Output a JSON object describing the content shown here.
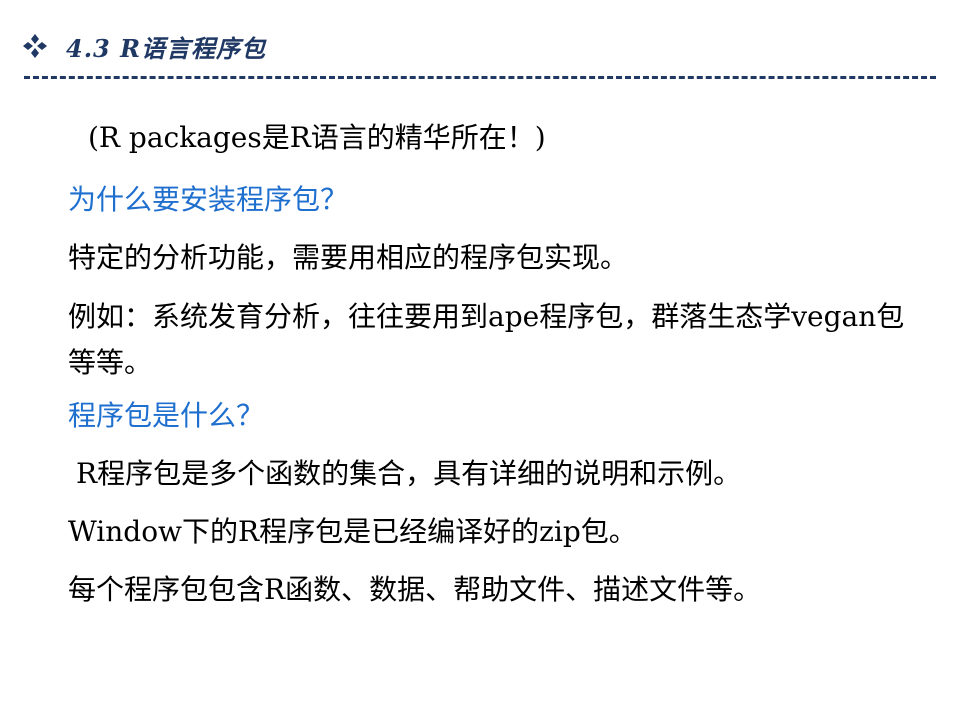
{
  "header": {
    "icon": "four-diamond-bullet-icon",
    "title": "4.3 R语言程序包",
    "title_color": "#1f3864"
  },
  "content": {
    "subtitle": "(R packages是R语言的精华所在！)",
    "q1": "为什么要安装程序包？",
    "a1": "特定的分析功能，需要用相应的程序包实现。",
    "example": "例如：系统发育分析，往往要用到ape程序包，群落生态学vegan包等等。",
    "q2": "程序包是什么？",
    "a2_line1": "R程序包是多个函数的集合，具有详细的说明和示例。",
    "a2_line2": "Window下的R程序包是已经编译好的zip包。",
    "a2_line3": "每个程序包包含R函数、数据、帮助文件、描述文件等。",
    "question_color": "#1f6fcf"
  }
}
